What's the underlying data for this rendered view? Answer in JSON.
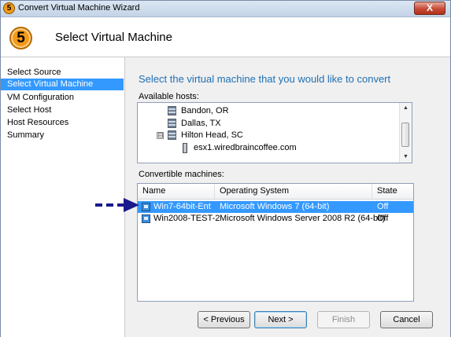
{
  "window": {
    "title": "Convert Virtual Machine Wizard",
    "close_label": "X",
    "icon_glyph": "5"
  },
  "header": {
    "step_number": "5",
    "title": "Select Virtual Machine"
  },
  "nav": {
    "items": [
      {
        "label": "Select Source",
        "active": false
      },
      {
        "label": "Select Virtual Machine",
        "active": true
      },
      {
        "label": "VM Configuration",
        "active": false
      },
      {
        "label": "Select Host",
        "active": false
      },
      {
        "label": "Host Resources",
        "active": false
      },
      {
        "label": "Summary",
        "active": false
      }
    ]
  },
  "content": {
    "instruction": "Select the virtual machine that you would like to convert",
    "hosts_label": "Available hosts:",
    "hosts": [
      {
        "label": "Bandon, OR",
        "icon": "datacenter-icon"
      },
      {
        "label": "Dallas, TX",
        "icon": "datacenter-icon"
      },
      {
        "label": "Hilton Head, SC",
        "icon": "datacenter-icon",
        "expander": "⊟"
      },
      {
        "label": "esx1.wiredbraincoffee.com",
        "icon": "server-icon"
      }
    ],
    "machines_label": "Convertible machines:",
    "columns": [
      "Name",
      "Operating System",
      "State"
    ],
    "machines": [
      {
        "name": "Win7-64bit-Ent",
        "os": "Microsoft Windows 7 (64-bit)",
        "state": "Off",
        "selected": true
      },
      {
        "name": "Win2008-TEST-2",
        "os": "Microsoft Windows Server 2008 R2 (64-bit)",
        "state": "Off",
        "selected": false
      }
    ]
  },
  "buttons": {
    "previous": "< Previous",
    "next": "Next >",
    "finish": "Finish",
    "cancel": "Cancel"
  },
  "colors": {
    "accent": "#3399ff",
    "instruction": "#1f6fb2",
    "badge": "#f39a18",
    "annotation_arrow": "#1a1a8c"
  }
}
